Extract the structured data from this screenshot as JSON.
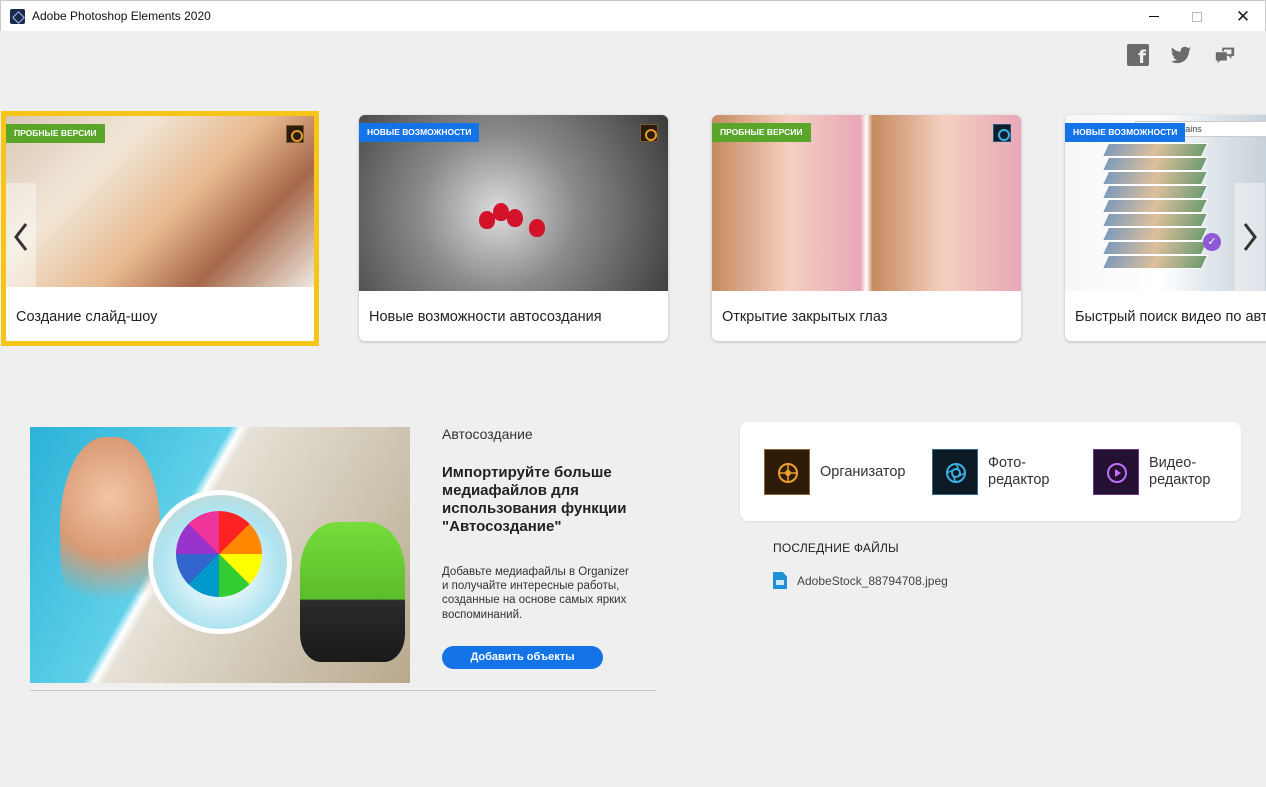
{
  "window": {
    "title": "Adobe Photoshop Elements 2020",
    "close_glyph": "✕"
  },
  "social": [
    "facebook-icon",
    "twitter-icon",
    "feedback-icon"
  ],
  "carousel": {
    "cards": [
      {
        "badge": "ПРОБНЫЕ ВЕРСИИ",
        "badge_color": "#5aa62a",
        "caption": "Создание слайд-шоу",
        "app": "organizer",
        "selected": true
      },
      {
        "badge": "НОВЫЕ ВОЗМОЖНОСТИ",
        "badge_color": "#1473e6",
        "caption": "Новые возможности автосоздания",
        "app": "organizer"
      },
      {
        "badge": "ПРОБНЫЕ ВЕРСИИ",
        "badge_color": "#5aa62a",
        "caption": "Открытие закрытых глаз",
        "app": "photo-editor"
      },
      {
        "badge": "НОВЫЕ ВОЗМОЖНОСТИ",
        "badge_color": "#1473e6",
        "caption": "Быстрый поиск видео по авто",
        "search_text": "on + mountains",
        "check_glyph": "✓"
      }
    ],
    "selected_border_color": "#f5c518"
  },
  "autocreate": {
    "label": "Автосоздание",
    "headline": "Импортируйте больше медиафайлов для использования функции \"Автосоздание\"",
    "body": "Добавьте медиафайлы в Organizer и получайте интересные работы, созданные на основе самых ярких воспоминаний.",
    "button": "Добавить объекты",
    "accent": "#1473e6"
  },
  "launcher": {
    "apps": [
      {
        "name": "Организатор",
        "icon": "organizer-icon"
      },
      {
        "name": "Фото-\nредактор",
        "icon": "photo-editor-icon"
      },
      {
        "name": "Видео-\nредактор",
        "icon": "video-editor-icon"
      }
    ]
  },
  "recent": {
    "heading": "ПОСЛЕДНИЕ ФАЙЛЫ",
    "files": [
      {
        "name": "AdobeStock_88794708.jpeg",
        "icon": "image-file-icon"
      }
    ]
  }
}
